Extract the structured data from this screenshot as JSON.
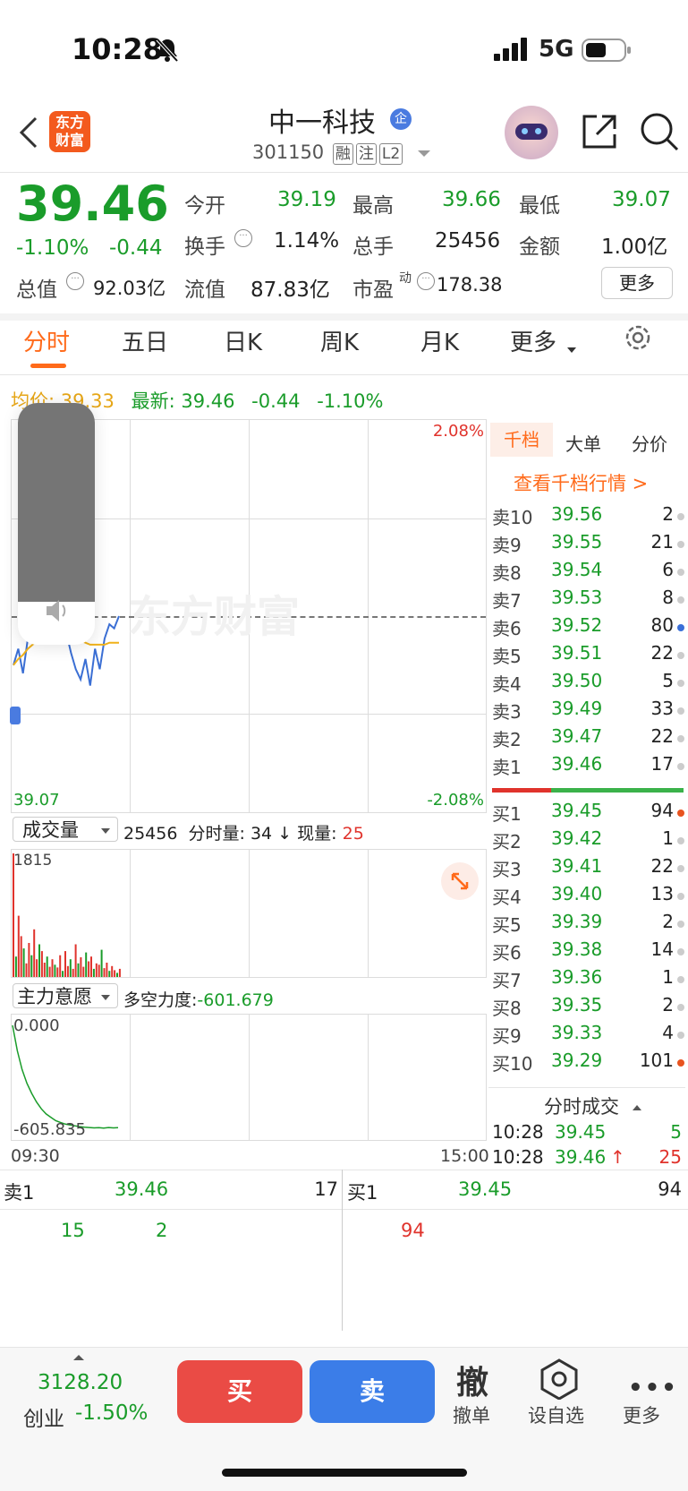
{
  "status_bar": {
    "time": "10:28",
    "network": "5G"
  },
  "header": {
    "logo_text": "东方财富",
    "title": "中一科技",
    "title_badge": "企",
    "code": "301150",
    "tags": [
      "融",
      "注",
      "L2"
    ]
  },
  "quote": {
    "price": "39.46",
    "pct": "-1.10%",
    "change": "-0.44",
    "fields": [
      {
        "label": "今开",
        "value": "39.19"
      },
      {
        "label": "最高",
        "value": "39.66"
      },
      {
        "label": "最低",
        "value": "39.07"
      },
      {
        "label": "换手",
        "value": "1.14%"
      },
      {
        "label": "总手",
        "value": "25456"
      },
      {
        "label": "金额",
        "value": "1.00亿"
      },
      {
        "label": "总值",
        "value": "92.03亿"
      },
      {
        "label": "流值",
        "value": "87.83亿"
      },
      {
        "label": "市盈",
        "sup": "动",
        "value": "178.38"
      }
    ],
    "more_button": "更多"
  },
  "tabs": [
    "分时",
    "五日",
    "日K",
    "周K",
    "月K",
    "更多"
  ],
  "infoline": {
    "avg_label": "均价:",
    "avg_value": "39.33",
    "latest_label": "最新:",
    "latest_value": "39.46",
    "latest_change": "-0.44",
    "latest_pct": "-1.10%"
  },
  "chart": {
    "pct_top": "2.08%",
    "pct_bottom": "-2.08%",
    "low_label": "39.07",
    "watermark": "东方财富",
    "volume_selector": "成交量",
    "volume_total": "25456",
    "volume_minute_label": "分时量:",
    "volume_minute_value": "34",
    "volume_now_label": "现量:",
    "volume_now_value": "25",
    "volume_max": "1815",
    "intent_selector": "主力意愿",
    "intent_label": "多空力度:",
    "intent_value": "-601.679",
    "intent_top": "0.000",
    "intent_bottom": "-605.835",
    "time_start": "09:30",
    "time_end": "15:00"
  },
  "chart_data": {
    "type": "line",
    "series": [
      {
        "values": [
          39.22,
          39.3,
          39.18,
          39.35,
          39.38,
          39.48,
          39.52,
          39.43,
          39.55,
          39.51,
          39.48,
          39.38,
          39.28,
          39.2,
          39.15,
          39.25,
          39.12,
          39.3,
          39.2,
          39.35,
          39.42,
          39.4,
          39.46
        ]
      },
      {
        "values": [
          39.22,
          39.25,
          39.27,
          39.3,
          39.32,
          39.34,
          39.35,
          39.36,
          39.37,
          39.38,
          39.38,
          39.37,
          39.36,
          39.35,
          39.34,
          39.33,
          39.32,
          39.32,
          39.32,
          39.32,
          39.33,
          39.33,
          39.33
        ]
      }
    ],
    "volume": [
      1815,
      300,
      900,
      600,
      420,
      200,
      500,
      320,
      700,
      260,
      480,
      380,
      210,
      300,
      150,
      260,
      180,
      140,
      320,
      90,
      380,
      160,
      260,
      120,
      480,
      200,
      290,
      150,
      360,
      230,
      300,
      120,
      200,
      180,
      400,
      130,
      210,
      90,
      160,
      100,
      60,
      120
    ],
    "intent": [
      0,
      -150,
      -260,
      -340,
      -400,
      -450,
      -490,
      -520,
      -540,
      -560,
      -570,
      -580,
      -585,
      -590,
      -595,
      -598,
      -600,
      -602,
      -601,
      -603,
      -600,
      -602,
      -601
    ]
  },
  "orderbook": {
    "tabs": [
      "千档",
      "大单",
      "分价"
    ],
    "link": "查看千档行情 >",
    "asks": [
      {
        "label": "卖10",
        "price": "39.56",
        "qty": "2"
      },
      {
        "label": "卖9",
        "price": "39.55",
        "qty": "21"
      },
      {
        "label": "卖8",
        "price": "39.54",
        "qty": "6"
      },
      {
        "label": "卖7",
        "price": "39.53",
        "qty": "8"
      },
      {
        "label": "卖6",
        "price": "39.52",
        "qty": "80"
      },
      {
        "label": "卖5",
        "price": "39.51",
        "qty": "22"
      },
      {
        "label": "卖4",
        "price": "39.50",
        "qty": "5"
      },
      {
        "label": "卖3",
        "price": "39.49",
        "qty": "33"
      },
      {
        "label": "卖2",
        "price": "39.47",
        "qty": "22"
      },
      {
        "label": "卖1",
        "price": "39.46",
        "qty": "17"
      }
    ],
    "bids": [
      {
        "label": "买1",
        "price": "39.45",
        "qty": "94"
      },
      {
        "label": "买2",
        "price": "39.42",
        "qty": "1"
      },
      {
        "label": "买3",
        "price": "39.41",
        "qty": "22"
      },
      {
        "label": "买4",
        "price": "39.40",
        "qty": "13"
      },
      {
        "label": "买5",
        "price": "39.39",
        "qty": "2"
      },
      {
        "label": "买6",
        "price": "39.38",
        "qty": "14"
      },
      {
        "label": "买7",
        "price": "39.36",
        "qty": "1"
      },
      {
        "label": "买8",
        "price": "39.35",
        "qty": "2"
      },
      {
        "label": "买9",
        "price": "39.33",
        "qty": "4"
      },
      {
        "label": "买10",
        "price": "39.29",
        "qty": "101"
      }
    ],
    "trades_title": "分时成交",
    "trades": [
      {
        "time": "10:28",
        "price": "39.45",
        "qty": "5"
      },
      {
        "time": "10:28",
        "price": "39.46",
        "qty": "25"
      }
    ]
  },
  "bottom_panel": {
    "ask_label": "卖1",
    "ask_price": "39.46",
    "ask_qty": "17",
    "bid_label": "买1",
    "bid_price": "39.45",
    "bid_qty": "94",
    "ask_parts": [
      "15",
      "2"
    ],
    "bid_parts": [
      "94"
    ]
  },
  "footer": {
    "index_value": "3128.20",
    "index_name": "创业",
    "index_pct": "-1.50%",
    "buy": "买",
    "sell": "卖",
    "cancel_glyph": "撤",
    "cancel_label": "撤单",
    "watch_label": "设自选",
    "more_label": "更多"
  }
}
